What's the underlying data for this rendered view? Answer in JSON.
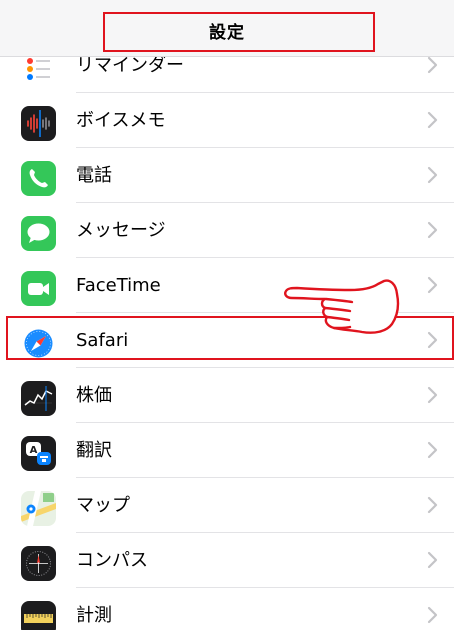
{
  "nav": {
    "title": "設定"
  },
  "colors": {
    "highlight": "#e0141e",
    "chevron": "#c4c4c7",
    "separator": "#e3e3e6"
  },
  "rows": [
    {
      "label": "リマインダー",
      "icon": "reminders-icon"
    },
    {
      "label": "ボイスメモ",
      "icon": "voice-memos-icon"
    },
    {
      "label": "電話",
      "icon": "phone-icon"
    },
    {
      "label": "メッセージ",
      "icon": "messages-icon"
    },
    {
      "label": "FaceTime",
      "icon": "facetime-icon"
    },
    {
      "label": "Safari",
      "icon": "safari-icon"
    },
    {
      "label": "株価",
      "icon": "stocks-icon"
    },
    {
      "label": "翻訳",
      "icon": "translate-icon"
    },
    {
      "label": "マップ",
      "icon": "maps-icon"
    },
    {
      "label": "コンパス",
      "icon": "compass-icon"
    },
    {
      "label": "計測",
      "icon": "measure-icon"
    }
  ]
}
